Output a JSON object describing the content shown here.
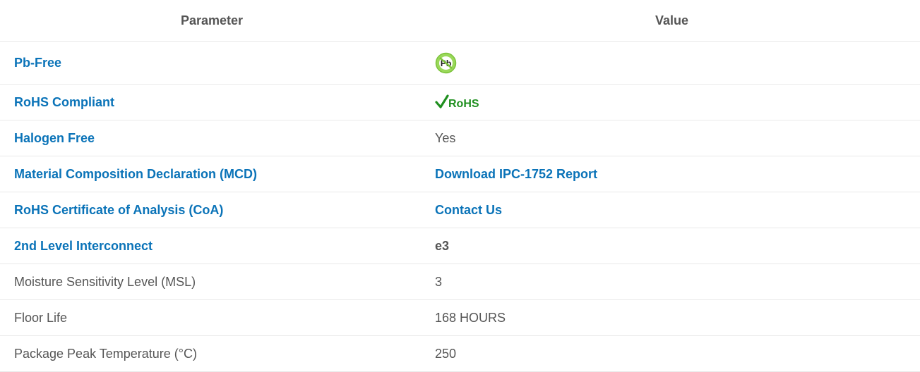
{
  "table": {
    "headers": {
      "parameter": "Parameter",
      "value": "Value"
    },
    "rows": [
      {
        "parameter": "Pb-Free",
        "value": "",
        "value_icon": "pb-free-icon"
      },
      {
        "parameter": "RoHS Compliant",
        "value": "",
        "value_icon": "rohs-compliant-icon",
        "badge_text": "RoHS"
      },
      {
        "parameter": "Halogen Free",
        "value": "Yes"
      },
      {
        "parameter": "Material Composition Declaration (MCD)",
        "value": "Download IPC-1752 Report"
      },
      {
        "parameter": "RoHS Certificate of Analysis (CoA)",
        "value": "Contact Us"
      },
      {
        "parameter": "2nd Level Interconnect",
        "value": "e3"
      },
      {
        "parameter": "Moisture Sensitivity Level (MSL)",
        "value": "3"
      },
      {
        "parameter": "Floor Life",
        "value": "168 HOURS"
      },
      {
        "parameter": "Package Peak Temperature (°C)",
        "value": "250"
      }
    ]
  },
  "colors": {
    "link": "#0a73b8",
    "text": "#555555",
    "badge_green": "#1f8f1f",
    "pb_badge_fill": "#8fd14f"
  }
}
